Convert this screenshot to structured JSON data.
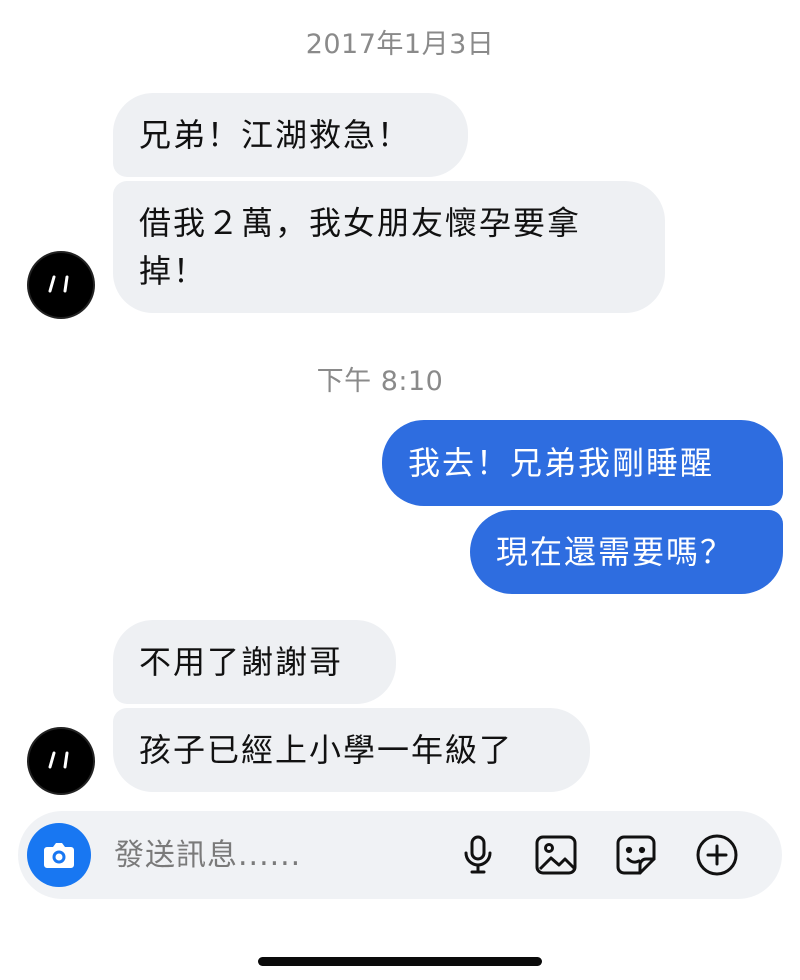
{
  "conversation": {
    "date_divider": "2017年1月3日",
    "time_divider": "下午 8:10",
    "messages": [
      {
        "side": "incoming",
        "text": "兄弟！江湖救急！"
      },
      {
        "side": "incoming",
        "lines": [
          "借我２萬，我女朋友懷孕要拿",
          "掉！"
        ]
      },
      {
        "side": "outgoing",
        "text": "我去！兄弟我剛睡醒"
      },
      {
        "side": "outgoing",
        "text": "現在還需要嗎？"
      },
      {
        "side": "incoming",
        "text": "不用了謝謝哥"
      },
      {
        "side": "incoming",
        "text": "孩子已經上小學一年級了"
      }
    ]
  },
  "composer": {
    "placeholder": "發送訊息......",
    "value": "",
    "icons": [
      "camera-icon",
      "microphone-icon",
      "image-icon",
      "sticker-icon",
      "add-icon"
    ]
  },
  "colors": {
    "outgoing_bubble": "#2e6de0",
    "incoming_bubble": "#eef0f3",
    "camera_button": "#1877f2",
    "timestamp_text": "#8a8a8a"
  }
}
